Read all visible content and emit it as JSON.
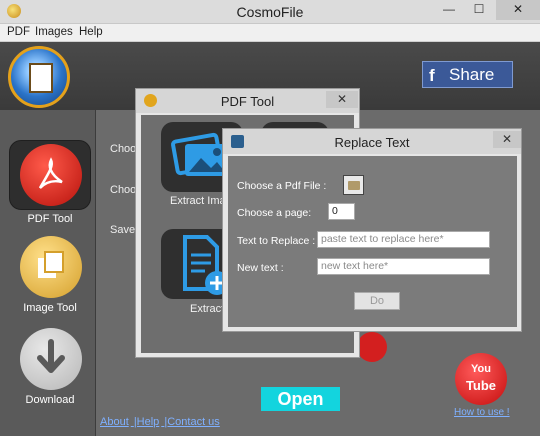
{
  "window": {
    "title": "CosmoFile",
    "minimize": "—",
    "maximize": "☐",
    "close": "✕"
  },
  "menu": [
    "PDF",
    "Images",
    "Help"
  ],
  "header": {
    "share_label": "Share",
    "share_f": "f"
  },
  "sidebar": [
    {
      "label": "PDF Tool"
    },
    {
      "label": "Image Tool"
    },
    {
      "label": "Download"
    }
  ],
  "main": {
    "choose_labels": [
      "Choo",
      "Choo",
      "Save"
    ],
    "open_label": "Open",
    "links": [
      "About",
      "|Help",
      "|Contact us"
    ],
    "youtube": {
      "you": "You",
      "tube": "Tube",
      "howto": "How to use !"
    }
  },
  "pdf_tool": {
    "title": "PDF Tool",
    "close": "✕",
    "tools": [
      {
        "label": "Extract Ima"
      },
      {
        "label": "Extract"
      }
    ]
  },
  "replace_text": {
    "title": "Replace Text",
    "close": "✕",
    "fields": {
      "pdf_file_label": "Choose a Pdf File :",
      "page_label": "Choose a page:",
      "page_value": "0",
      "replace_label": "Text to Replace :",
      "replace_placeholder": "paste text to replace here*",
      "new_label": "New text :",
      "new_placeholder": "new text here*"
    },
    "do_label": "Do"
  },
  "colors": {
    "accent_open": "#13d4de",
    "facebook": "#3b5998",
    "youtube": "#c40d0d"
  }
}
